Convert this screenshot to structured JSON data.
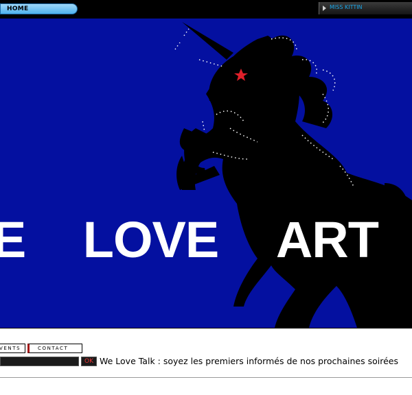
{
  "header": {
    "home_label": "HOME",
    "artist_label": "MISS KITTIN"
  },
  "banner": {
    "words": [
      "WE",
      "LOVE",
      "ART"
    ],
    "background": "#0410a0",
    "text_color": "#ffffff"
  },
  "nav": {
    "events_label": "EVENTS",
    "contact_label": "CONTACT"
  },
  "newsletter": {
    "email_value": "",
    "ok_label": "OK",
    "text": "We Love Talk : soyez les premiers informés de nos prochaines soirées"
  }
}
